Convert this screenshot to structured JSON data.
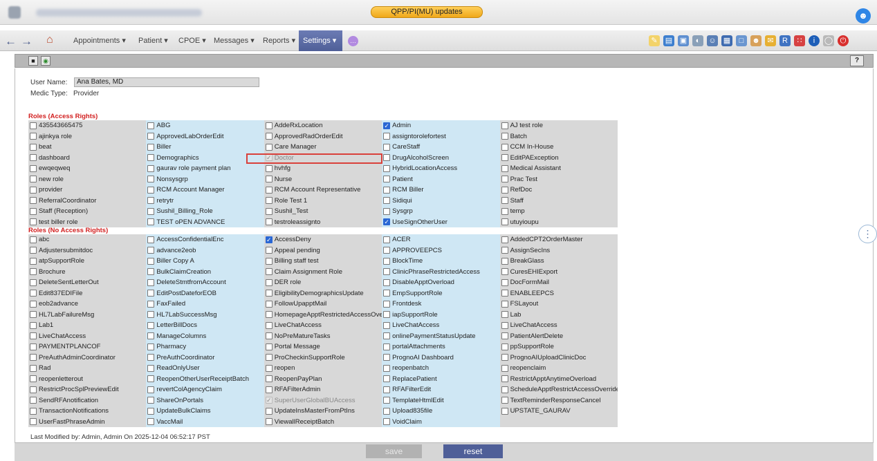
{
  "header": {
    "qpp_button": "QPP/PI(MU) updates",
    "user_icon": "user-icon"
  },
  "nav": {
    "menus": [
      "Appointments ▾",
      "Patient ▾",
      "CPOE ▾",
      "Messages ▾",
      "Reports ▾",
      "Settings ▾"
    ],
    "active": "Settings ▾"
  },
  "subbar": {
    "help": "?"
  },
  "user": {
    "name_label": "User Name:",
    "name_value": "Ana Bates, MD",
    "medic_label": "Medic Type:",
    "medic_value": "Provider"
  },
  "sections": [
    {
      "title": "Roles (Access Rights)",
      "rows": [
        [
          {
            "l": "435543665475"
          },
          {
            "l": "ABG"
          },
          {
            "l": "AddeRxLocation"
          },
          {
            "l": "Admin",
            "c": true
          },
          {
            "l": "AJ test role"
          }
        ],
        [
          {
            "l": "ajinkya role"
          },
          {
            "l": "ApprovedLabOrderEdit"
          },
          {
            "l": "ApprovedRadOrderEdit"
          },
          {
            "l": "assigntorolefortest"
          },
          {
            "l": "Batch"
          }
        ],
        [
          {
            "l": "beat"
          },
          {
            "l": "Biller"
          },
          {
            "l": "Care Manager"
          },
          {
            "l": "CareStaff"
          },
          {
            "l": "CCM In-House"
          }
        ],
        [
          {
            "l": "dashboard"
          },
          {
            "l": "Demographics"
          },
          {
            "l": "Doctor",
            "d": true
          },
          {
            "l": "DrugAlcoholScreen"
          },
          {
            "l": "EditPAException"
          }
        ],
        [
          {
            "l": "ewqeqweq"
          },
          {
            "l": "gaurav role payment plan"
          },
          {
            "l": "hvhfg"
          },
          {
            "l": "HybridLocationAccess"
          },
          {
            "l": "Medical Assistant"
          }
        ],
        [
          {
            "l": "new role"
          },
          {
            "l": "Nonsysgrp"
          },
          {
            "l": "Nurse"
          },
          {
            "l": "Patient"
          },
          {
            "l": "Prac Test"
          }
        ],
        [
          {
            "l": "provider"
          },
          {
            "l": "RCM Account Manager"
          },
          {
            "l": "RCM Account Representative"
          },
          {
            "l": "RCM Biller"
          },
          {
            "l": "RefDoc"
          }
        ],
        [
          {
            "l": "ReferralCoordinator"
          },
          {
            "l": "retrytr"
          },
          {
            "l": "Role Test 1"
          },
          {
            "l": "Sidiqui"
          },
          {
            "l": "Staff"
          }
        ],
        [
          {
            "l": "Staff (Reception)"
          },
          {
            "l": "Sushil_Billing_Role"
          },
          {
            "l": "Sushil_Test"
          },
          {
            "l": "Sysgrp"
          },
          {
            "l": "temp"
          }
        ],
        [
          {
            "l": "test biller role"
          },
          {
            "l": "TEST oPEN ADVANCE"
          },
          {
            "l": "testroleassignto"
          },
          {
            "l": "UseSignOtherUser",
            "c": true
          },
          {
            "l": "utuyioupu"
          }
        ]
      ]
    },
    {
      "title": "Roles (No Access Rights)",
      "rows": [
        [
          {
            "l": "abc"
          },
          {
            "l": "AccessConfidentialEnc"
          },
          {
            "l": "AccessDeny",
            "c": true
          },
          {
            "l": "ACER"
          },
          {
            "l": "AddedCPT2OrderMaster"
          }
        ],
        [
          {
            "l": "Adjustersubmitdoc"
          },
          {
            "l": "advance2eob"
          },
          {
            "l": "Appeal pending"
          },
          {
            "l": "APPROVEEPCS"
          },
          {
            "l": "AssignSecIns"
          }
        ],
        [
          {
            "l": "atpSupportRole"
          },
          {
            "l": "Biller Copy A"
          },
          {
            "l": "Billing staff test"
          },
          {
            "l": "BlockTime"
          },
          {
            "l": "BreakGlass"
          }
        ],
        [
          {
            "l": "Brochure"
          },
          {
            "l": "BulkClaimCreation"
          },
          {
            "l": "Claim Assignment Role"
          },
          {
            "l": "ClinicPhraseRestrictedAccess"
          },
          {
            "l": "CuresEHIExport"
          }
        ],
        [
          {
            "l": "DeleteSentLetterOut"
          },
          {
            "l": "DeleteStmtfromAccount"
          },
          {
            "l": "DER role"
          },
          {
            "l": "DisableApptOverload"
          },
          {
            "l": "DocFormMail"
          }
        ],
        [
          {
            "l": "Edit837EDIFile"
          },
          {
            "l": "EditPostDateforEOB"
          },
          {
            "l": "EligibilityDemographicsUpdate"
          },
          {
            "l": "EmpSupportRole"
          },
          {
            "l": "ENABLEEPCS"
          }
        ],
        [
          {
            "l": "eob2advance"
          },
          {
            "l": "FaxFailed"
          },
          {
            "l": "FollowUpapptMail"
          },
          {
            "l": "Frontdesk"
          },
          {
            "l": "FSLayout"
          }
        ],
        [
          {
            "l": "HL7LabFailureMsg"
          },
          {
            "l": "HL7LabSuccessMsg"
          },
          {
            "l": "HomepageApptRestrictedAccessOverride"
          },
          {
            "l": "iapSupportRole"
          },
          {
            "l": "Lab"
          }
        ],
        [
          {
            "l": "Lab1"
          },
          {
            "l": "LetterBillDocs"
          },
          {
            "l": "LiveChatAccess"
          },
          {
            "l": "LiveChatAccess"
          },
          {
            "l": "LiveChatAccess"
          }
        ],
        [
          {
            "l": "LiveChatAccess"
          },
          {
            "l": "ManageColumns"
          },
          {
            "l": "NoPreMatureTasks"
          },
          {
            "l": "onlinePaymentStatusUpdate"
          },
          {
            "l": "PatientAlertDelete"
          }
        ],
        [
          {
            "l": "PAYMENTPLANCOF"
          },
          {
            "l": "Pharmacy"
          },
          {
            "l": "Portal Message"
          },
          {
            "l": "portalAttachments"
          },
          {
            "l": "ppSupportRole"
          }
        ],
        [
          {
            "l": "PreAuthAdminCoordinator"
          },
          {
            "l": "PreAuthCoordinator"
          },
          {
            "l": "ProCheckinSupportRole"
          },
          {
            "l": "PrognoAI Dashboard"
          },
          {
            "l": "PrognoAIUploadClinicDoc"
          }
        ],
        [
          {
            "l": "Rad"
          },
          {
            "l": "ReadOnlyUser"
          },
          {
            "l": "reopen"
          },
          {
            "l": "reopenbatch"
          },
          {
            "l": "reopenclaim"
          }
        ],
        [
          {
            "l": "reopenletterout"
          },
          {
            "l": "ReopenOtherUserReceiptBatch"
          },
          {
            "l": "ReopenPayPlan"
          },
          {
            "l": "ReplacePatient"
          },
          {
            "l": "RestrictApptAnytimeOverload"
          }
        ],
        [
          {
            "l": "RestrictProcSplPreviewEdit"
          },
          {
            "l": "revertColAgencyClaim"
          },
          {
            "l": "RFAFilterAdmin"
          },
          {
            "l": "RFAFilterEdit"
          },
          {
            "l": "ScheduleApptRestrictAccessOverride"
          }
        ],
        [
          {
            "l": "SendRFAnotification"
          },
          {
            "l": "ShareOnPortals"
          },
          {
            "l": "SuperUserGlobalBUAccess",
            "d": true
          },
          {
            "l": "TemplateHtmlEdit"
          },
          {
            "l": "TextReminderResponseCancel"
          }
        ],
        [
          {
            "l": "TransactionNotifications"
          },
          {
            "l": "UpdateBulkClaims"
          },
          {
            "l": "UpdateInsMasterFromPtIns"
          },
          {
            "l": "Upload835file"
          },
          {
            "l": "UPSTATE_GAURAV"
          }
        ],
        [
          {
            "l": "UserFastPhraseAdmin"
          },
          {
            "l": "VaccMail"
          },
          {
            "l": "ViewallReceiptBatch"
          },
          {
            "l": "VoidClaim"
          },
          null
        ]
      ]
    }
  ],
  "footer": {
    "last_modified": "Last Modified by: Admin, Admin On 2025-12-04 06:52:17 PST",
    "save": "save",
    "reset": "reset"
  },
  "colors": {
    "accent": "#4f5f98",
    "section_title": "#d21f1f",
    "checked": "#2a67d4",
    "col_gray": "#d8d8d8",
    "col_blue": "#cfe7f4"
  }
}
